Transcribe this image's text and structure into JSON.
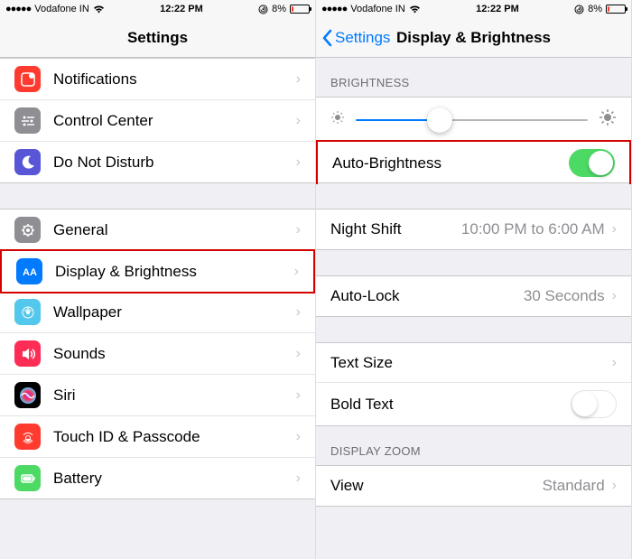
{
  "statusbar": {
    "carrier": "Vodafone IN",
    "time": "12:22 PM",
    "battery_pct": "8%"
  },
  "left": {
    "title": "Settings",
    "group1": [
      {
        "label": "Notifications",
        "icon": "notifications",
        "bg": "#ff3b30"
      },
      {
        "label": "Control Center",
        "icon": "control-center",
        "bg": "#8e8e93"
      },
      {
        "label": "Do Not Disturb",
        "icon": "dnd",
        "bg": "#5856d6"
      }
    ],
    "group2": [
      {
        "label": "General",
        "icon": "general",
        "bg": "#8e8e93"
      },
      {
        "label": "Display & Brightness",
        "icon": "display",
        "bg": "#007aff",
        "highlight": true
      },
      {
        "label": "Wallpaper",
        "icon": "wallpaper",
        "bg": "#54c7ec"
      },
      {
        "label": "Sounds",
        "icon": "sounds",
        "bg": "#ff2d55"
      },
      {
        "label": "Siri",
        "icon": "siri",
        "bg": "#000"
      },
      {
        "label": "Touch ID & Passcode",
        "icon": "touchid",
        "bg": "#ff3b30"
      },
      {
        "label": "Battery",
        "icon": "battery",
        "bg": "#4cd964"
      }
    ]
  },
  "right": {
    "back": "Settings",
    "title": "Display & Brightness",
    "sections": {
      "brightness_header": "BRIGHTNESS",
      "auto_brightness": "Auto-Brightness",
      "night_shift": {
        "label": "Night Shift",
        "detail": "10:00 PM to 6:00 AM"
      },
      "auto_lock": {
        "label": "Auto-Lock",
        "detail": "30 Seconds"
      },
      "text_size": "Text Size",
      "bold_text": "Bold Text",
      "display_zoom_header": "DISPLAY ZOOM",
      "view": {
        "label": "View",
        "detail": "Standard"
      }
    },
    "brightness_value_pct": 36
  }
}
